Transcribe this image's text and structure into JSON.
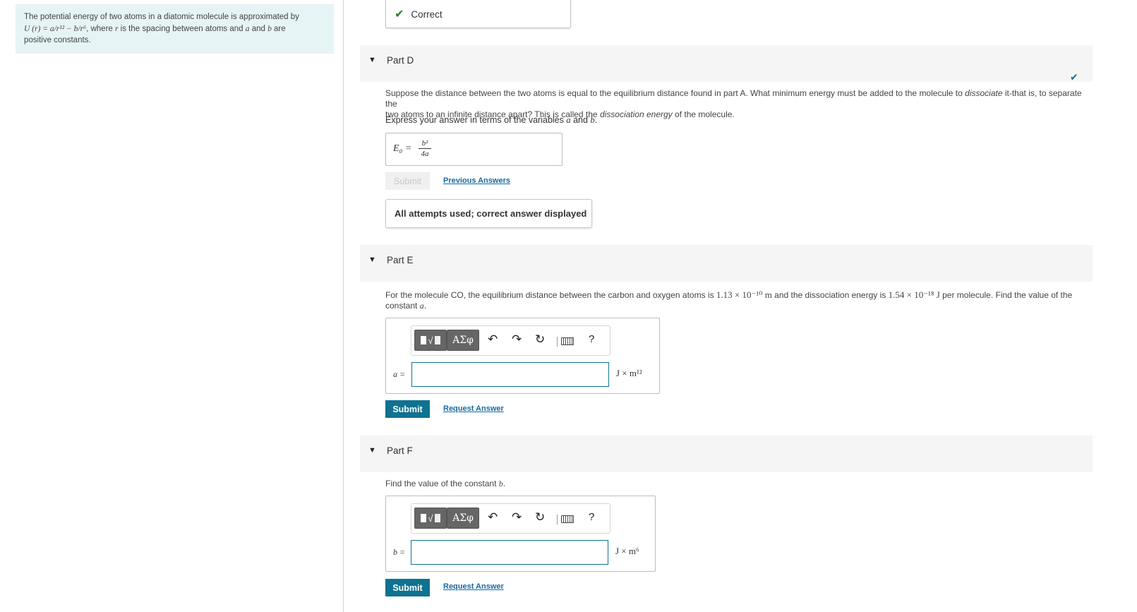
{
  "intro": {
    "line1": "The potential energy of two atoms in a diatomic molecule is approximated by",
    "formula": "U (r) = a/r¹² − b/r⁶",
    "line2_mid": ", where ",
    "var_r": "r",
    "line2_after": " is the spacing between atoms and ",
    "var_a": "a",
    "and": " and ",
    "var_b": "b",
    "are": " are",
    "line3": "positive constants."
  },
  "top_feedback": {
    "label": "Correct"
  },
  "partD": {
    "title": "Part D",
    "text1": "Suppose the distance between the two atoms is equal to the equilibrium distance found in part A. What minimum energy must be added to the molecule to ",
    "em1": "dissociate",
    "text2": " it-that is, to separate the",
    "text3": "two atoms to an infinite distance apart? This is called the ",
    "em2": "dissociation energy",
    "text4": " of the molecule.",
    "express": "Express your answer in terms of the variables ",
    "express_a": "a",
    "express_and": " and ",
    "express_b": "b",
    "express_end": ".",
    "answer_lhs": "E₀ =",
    "answer_num": "b²",
    "answer_den": "4a",
    "submit": "Submit",
    "previous": "Previous Answers",
    "attempts": "All attempts used; correct answer displayed"
  },
  "partE": {
    "title": "Part E",
    "text1": "For the molecule CO, the equilibrium distance between the carbon and oxygen atoms is ",
    "dist": "1.13 × 10⁻¹⁰ m",
    "text2": " and the dissociation energy is ",
    "energy": "1.54 × 10⁻¹⁸ J",
    "text3": " per molecule. Find the value of the",
    "text4": "constant ",
    "var": "a",
    "var_label": "a =",
    "input_value": "",
    "units": "J × m¹²",
    "submit": "Submit",
    "request": "Request Answer"
  },
  "partF": {
    "title": "Part F",
    "text1": "Find the value of the constant ",
    "var": "b",
    "var_label": "b =",
    "input_value": "",
    "units": "J × m⁶",
    "submit": "Submit",
    "request": "Request Answer"
  },
  "toolbar": {
    "greek": "ΑΣφ",
    "template_icon": "fraction-sqrt-template-icon",
    "undo_icon": "undo-icon",
    "redo_icon": "redo-icon",
    "reset_icon": "reset-icon",
    "keyboard_icon": "keyboard-icon",
    "help": "?"
  },
  "colors": {
    "accent": "#0f7291",
    "intro_bg": "#e6f4f6",
    "check": "#2e7d32"
  }
}
